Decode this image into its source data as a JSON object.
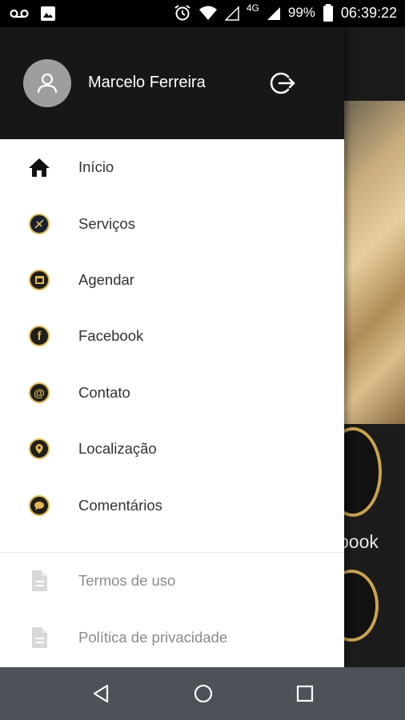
{
  "status_bar": {
    "network": "4G",
    "battery": "99%",
    "time": "06:39:22",
    "icons": [
      "voicemail-icon",
      "image-icon",
      "alarm-icon",
      "wifi-icon",
      "signal-icon",
      "signal-icon",
      "battery-icon"
    ]
  },
  "background": {
    "label_partial": "book"
  },
  "drawer": {
    "user_name": "Marcelo Ferreira",
    "logout_icon": "logout-icon",
    "items": [
      {
        "label": "Início",
        "icon": "home-icon"
      },
      {
        "label": "Serviços",
        "icon": "services-icon"
      },
      {
        "label": "Agendar",
        "icon": "calendar-icon"
      },
      {
        "label": "Facebook",
        "icon": "facebook-icon"
      },
      {
        "label": "Contato",
        "icon": "at-icon"
      },
      {
        "label": "Localização",
        "icon": "location-icon"
      },
      {
        "label": "Comentários",
        "icon": "comment-icon"
      }
    ],
    "secondary_items": [
      {
        "label": "Termos de uso",
        "icon": "document-icon"
      },
      {
        "label": "Política de privacidade",
        "icon": "document-icon"
      }
    ]
  },
  "nav_bar": {
    "icons": [
      "back-icon",
      "home-circle-icon",
      "recents-icon"
    ]
  },
  "colors": {
    "accent_gold": "#e0b84c",
    "drawer_header": "#171717",
    "nav_bar": "#4c5258"
  }
}
